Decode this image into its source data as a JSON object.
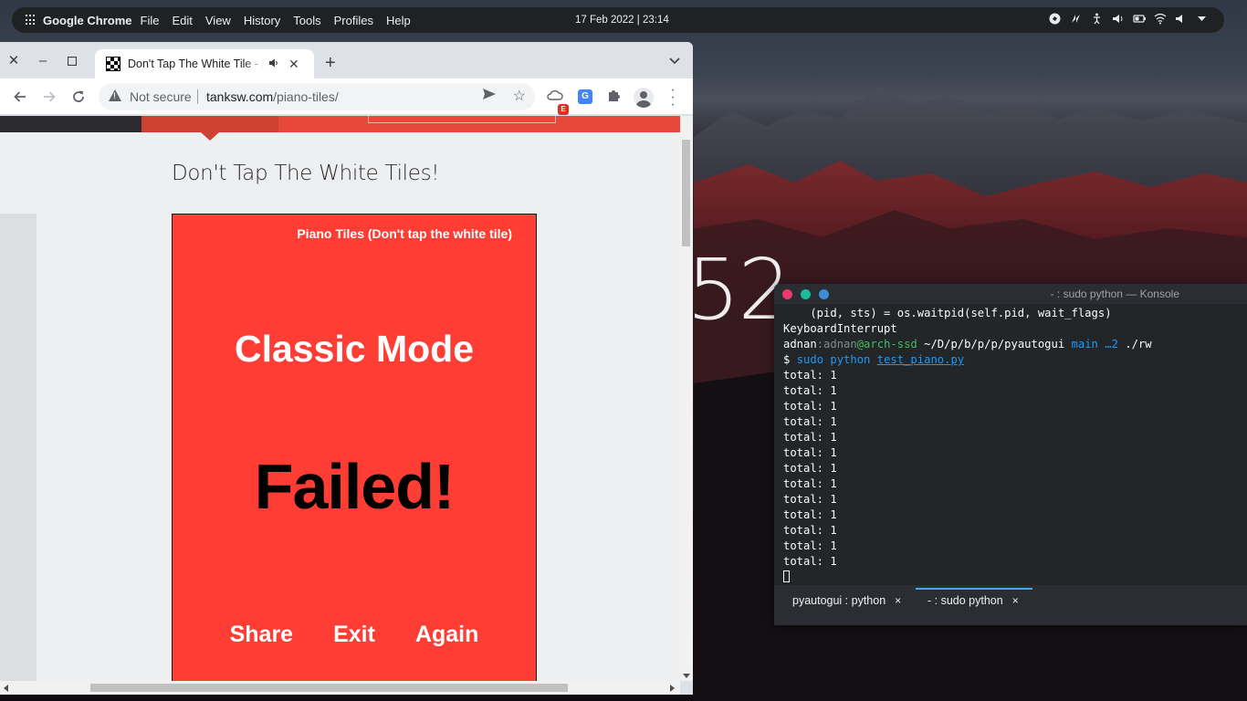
{
  "topbar": {
    "app_name": "Google Chrome",
    "menu": [
      "File",
      "Edit",
      "View",
      "History",
      "Tools",
      "Profiles",
      "Help"
    ],
    "clock": "17 Feb 2022  |  23:14",
    "tray_icons": [
      "kde-connect-icon",
      "network-speed-icon",
      "accessibility-icon",
      "volume-icon",
      "battery-icon",
      "wifi-icon",
      "speaker-icon",
      "dropdown-arrow-icon"
    ]
  },
  "desktop": {
    "clock_fragment": "52"
  },
  "chrome": {
    "tab_title": "Don't Tap The White Tile - F",
    "new_tab": "+",
    "omnibox": {
      "security_label": "Not secure",
      "host": "tanksw.com",
      "path": "/piano-tiles/"
    },
    "extension_badge": "E",
    "translate_glyph": "G"
  },
  "page": {
    "heading": "Don't Tap The White Tiles!",
    "game": {
      "title": "Piano Tiles (Don't tap the white tile)",
      "mode": "Classic Mode",
      "status": "Failed!",
      "actions": [
        "Share",
        "Exit",
        "Again"
      ]
    }
  },
  "konsole": {
    "title": "- : sudo python — Konsole",
    "lines": {
      "l1": "    (pid, sts) = os.waitpid(self.pid, wait_flags)",
      "l2": "KeyboardInterrupt",
      "user": "adnan",
      "host_sep": ":",
      "host_user": "adnan",
      "at_host": "@arch-ssd",
      "cwd": " ~/D/p/b/p/p/pyautogui ",
      "branch": "main",
      "branch_info": " …2 ",
      "cmd_tail": "./rw",
      "prompt": "$ ",
      "cmd_sudo": "sudo python ",
      "cmd_file": "test_piano.py",
      "total_line": "total: 1"
    },
    "tabs": [
      {
        "label": "pyautogui : python",
        "close": "×"
      },
      {
        "label": "- : sudo python",
        "close": "×"
      }
    ],
    "dot_colors": [
      "#e93a6b",
      "#1abc9c",
      "#3d8bd9"
    ]
  }
}
